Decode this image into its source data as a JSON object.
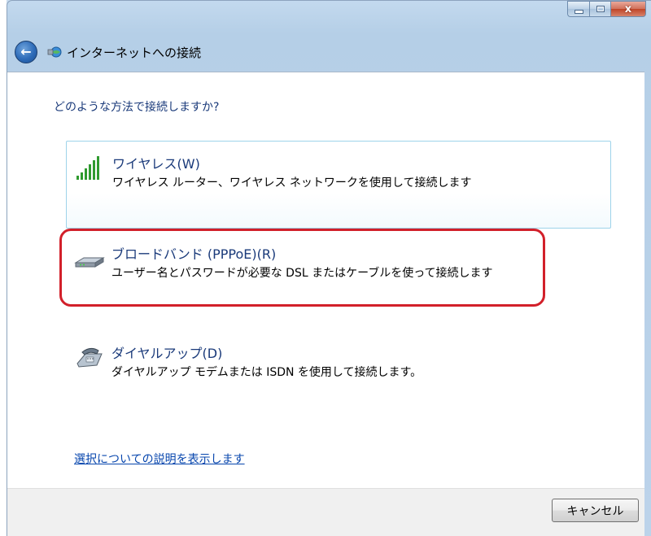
{
  "window": {
    "title": "インターネットへの接続",
    "close_glyph": "x"
  },
  "content": {
    "question": "どのような方法で接続しますか?",
    "options": [
      {
        "title": "ワイヤレス(W)",
        "description": "ワイヤレス ルーター、ワイヤレス ネットワークを使用して接続します",
        "icon": "signal-bars-icon"
      },
      {
        "title": "ブロードバンド (PPPoE)(R)",
        "description": "ユーザー名とパスワードが必要な DSL またはケーブルを使って接続します",
        "icon": "modem-icon"
      },
      {
        "title": "ダイヤルアップ(D)",
        "description": "ダイヤルアップ モデムまたは ISDN を使用して接続します。",
        "icon": "phone-icon"
      }
    ],
    "help_link": "選択についての説明を表示します"
  },
  "footer": {
    "cancel_label": "キャンセル"
  },
  "colors": {
    "highlight": "#d2202a",
    "link": "#0645ad",
    "heading": "#1a3a7a"
  }
}
